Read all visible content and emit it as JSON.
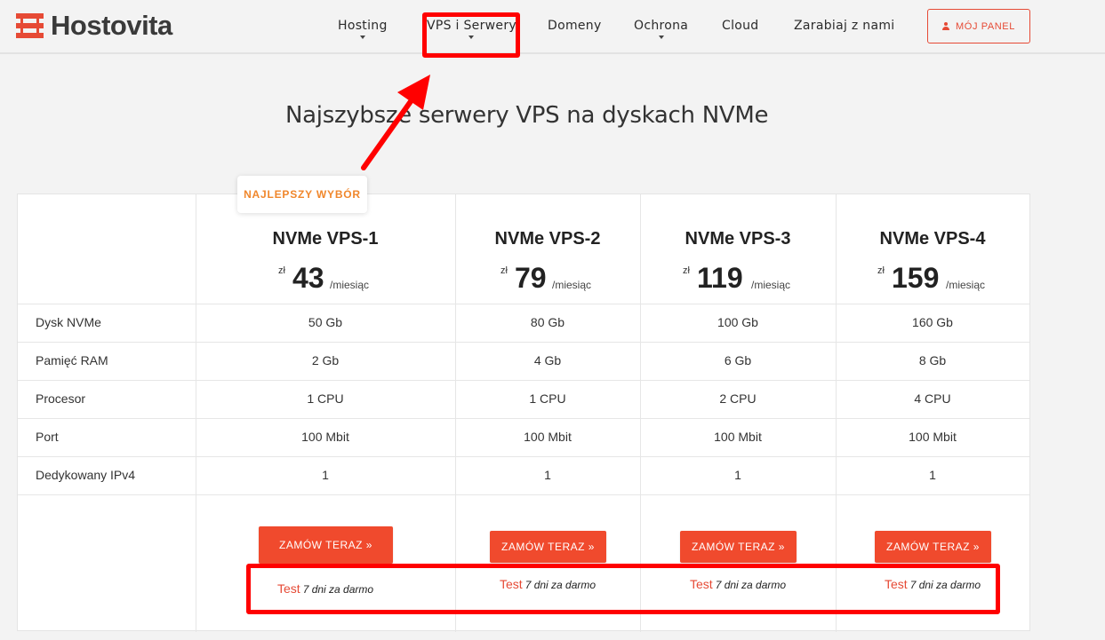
{
  "header": {
    "logo_text": "Hostovita",
    "nav": [
      {
        "label": "Hosting",
        "has_dropdown": true
      },
      {
        "label": "VPS i Serwery",
        "has_dropdown": true
      },
      {
        "label": "Domeny",
        "has_dropdown": false
      },
      {
        "label": "Ochrona",
        "has_dropdown": true
      },
      {
        "label": "Cloud",
        "has_dropdown": false
      },
      {
        "label": "Zarabiaj z nami",
        "has_dropdown": false
      }
    ],
    "panel_button": "MÓJ PANEL"
  },
  "title": "Najszybsze serwery VPS na dyskach NVMe",
  "badge": "NAJLEPSZY WYBÓR",
  "plans": [
    {
      "name": "NVMe VPS-1",
      "currency": "zł",
      "price": "43",
      "period": "/miesiąc",
      "values": [
        "50 Gb",
        "2 Gb",
        "1 CPU",
        "100 Mbit",
        "1"
      ],
      "order_label": "ZAMÓW TERAZ »",
      "trial_link": "Test",
      "trial_text": "7 dni za darmo"
    },
    {
      "name": "NVMe VPS-2",
      "currency": "zł",
      "price": "79",
      "period": "/miesiąc",
      "values": [
        "80 Gb",
        "4 Gb",
        "1 CPU",
        "100 Mbit",
        "1"
      ],
      "order_label": "ZAMÓW TERAZ »",
      "trial_link": "Test",
      "trial_text": "7 dni za darmo"
    },
    {
      "name": "NVMe VPS-3",
      "currency": "zł",
      "price": "119",
      "period": "/miesiąc",
      "values": [
        "100 Gb",
        "6 Gb",
        "2 CPU",
        "100 Mbit",
        "1"
      ],
      "order_label": "ZAMÓW TERAZ »",
      "trial_link": "Test",
      "trial_text": "7 dni za darmo"
    },
    {
      "name": "NVMe VPS-4",
      "currency": "zł",
      "price": "159",
      "period": "/miesiąc",
      "values": [
        "160 Gb",
        "8 Gb",
        "4 CPU",
        "100 Mbit",
        "1"
      ],
      "order_label": "ZAMÓW TERAZ »",
      "trial_link": "Test",
      "trial_text": "7 dni za darmo"
    }
  ],
  "rows": [
    "Dysk NVMe",
    "Pamięć RAM",
    "Procesor",
    "Port",
    "Dedykowany IPv4"
  ],
  "colors": {
    "accent": "#f04a2d",
    "badge": "#f0872c",
    "annotation": "#ff0000"
  },
  "icons": {
    "panel": "user-icon",
    "logo": "logo-icon"
  }
}
